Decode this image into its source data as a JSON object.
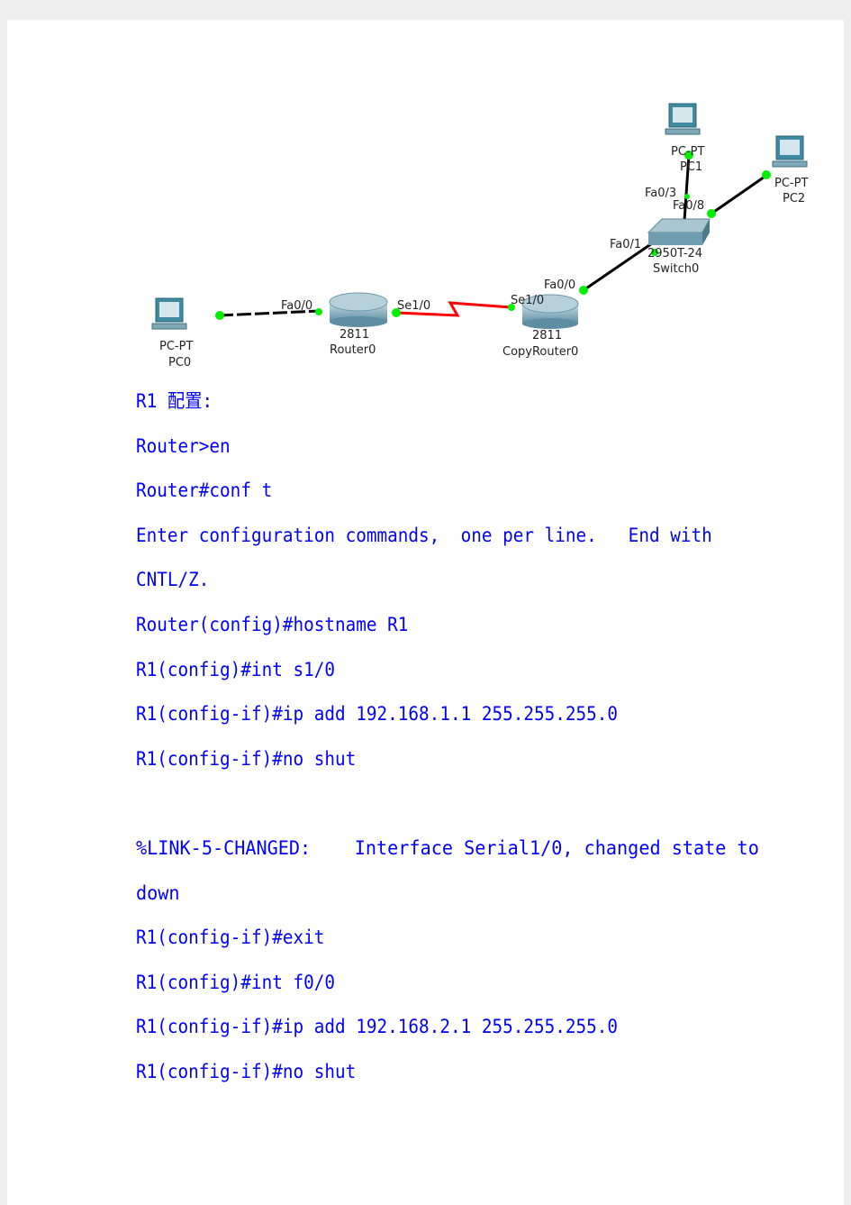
{
  "diagram": {
    "devices": [
      {
        "model": "PC-PT",
        "name": "PC0"
      },
      {
        "model": "2811",
        "name": "Router0"
      },
      {
        "model": "2811",
        "name": "CopyRouter0"
      },
      {
        "model": "2950T-24",
        "name": "Switch0"
      },
      {
        "model": "PC-PT",
        "name": "PC1"
      },
      {
        "model": "PC-PT",
        "name": "PC2"
      }
    ],
    "ports": {
      "r0_fa": "Fa0/0",
      "r0_se": "Se1/0",
      "r1_se": "Se1/0",
      "r1_fa": "Fa0/0",
      "sw_fa1": "Fa0/1",
      "sw_fa3": "Fa0/3",
      "sw_fa8": "Fa0/8"
    },
    "colors": {
      "link": "#000000",
      "serial": "#ff0000",
      "port_up": "#00ee00"
    }
  },
  "lines": [
    "R1 配置:",
    "Router>en",
    "Router#conf t",
    "Enter configuration commands,  one per line.   End with",
    "CNTL/Z.",
    "Router(config)#hostname R1",
    "R1(config)#int s1/0",
    "R1(config-if)#ip add 192.168.1.1 255.255.255.0",
    "R1(config-if)#no shut",
    "",
    "%LINK-5-CHANGED:    Interface Serial1/0, changed state to",
    "down",
    "R1(config-if)#exit",
    "R1(config)#int f0/0",
    "R1(config-if)#ip add 192.168.2.1 255.255.255.0",
    "R1(config-if)#no shut"
  ],
  "text_color": "#0000ff"
}
